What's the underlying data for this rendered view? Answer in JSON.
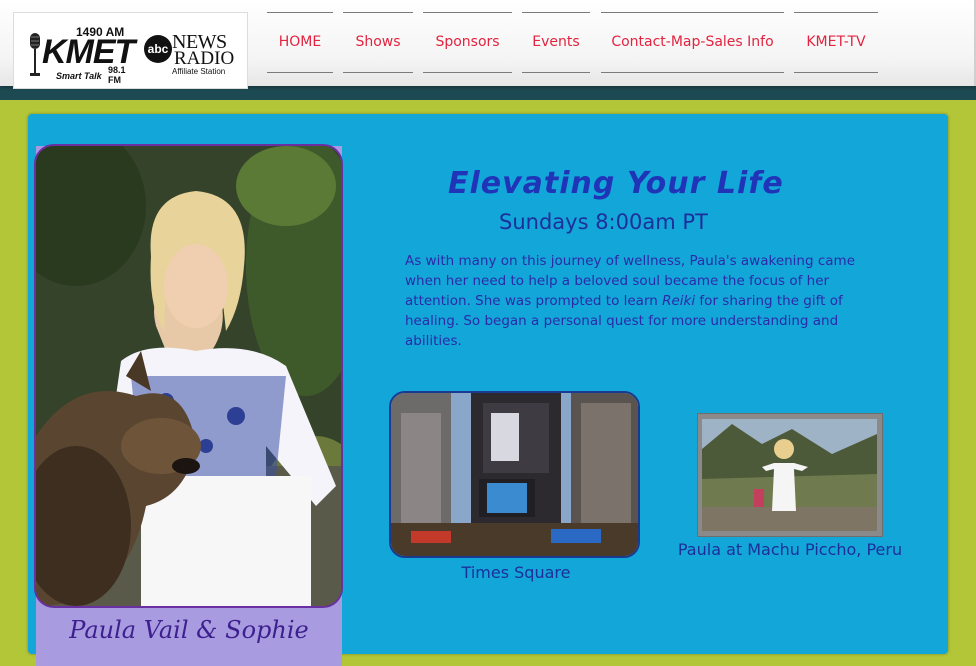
{
  "header": {
    "logo": {
      "kmet_am": "1490 AM",
      "kmet_name": "KMET",
      "kmet_tagline": "Smart Talk",
      "kmet_fm": "98.1 FM",
      "abc_mark": "abc",
      "abc_news": "NEWS",
      "abc_radio": "RADIO",
      "abc_affiliate": "Affiliate Station"
    },
    "nav": [
      {
        "label": "HOME"
      },
      {
        "label": "Shows"
      },
      {
        "label": "Sponsors"
      },
      {
        "label": "Events"
      },
      {
        "label": "Contact-Map-Sales Info"
      },
      {
        "label": "KMET-TV"
      }
    ]
  },
  "colors": {
    "background": "#b3c637",
    "panel": "#13a6d9",
    "nav_text": "#e3233f",
    "title": "#2034b8",
    "card": "#a99be0"
  },
  "main": {
    "title": "Elevating Your Life",
    "schedule": "Sundays  8:00am PT",
    "bio_part1": "As with many on this journey of wellness, Paula's awakening came when her need to help a beloved soul became the focus of her attention. She was prompted to learn ",
    "bio_em": "Reiki",
    "bio_part2": " for sharing the gift of healing. So began a personal quest for more understanding and abilities.",
    "host_caption": "Paula Vail & Sophie",
    "times_square_caption": "Times Square",
    "machu_picchu_caption": "Paula at Machu Piccho, Peru"
  }
}
